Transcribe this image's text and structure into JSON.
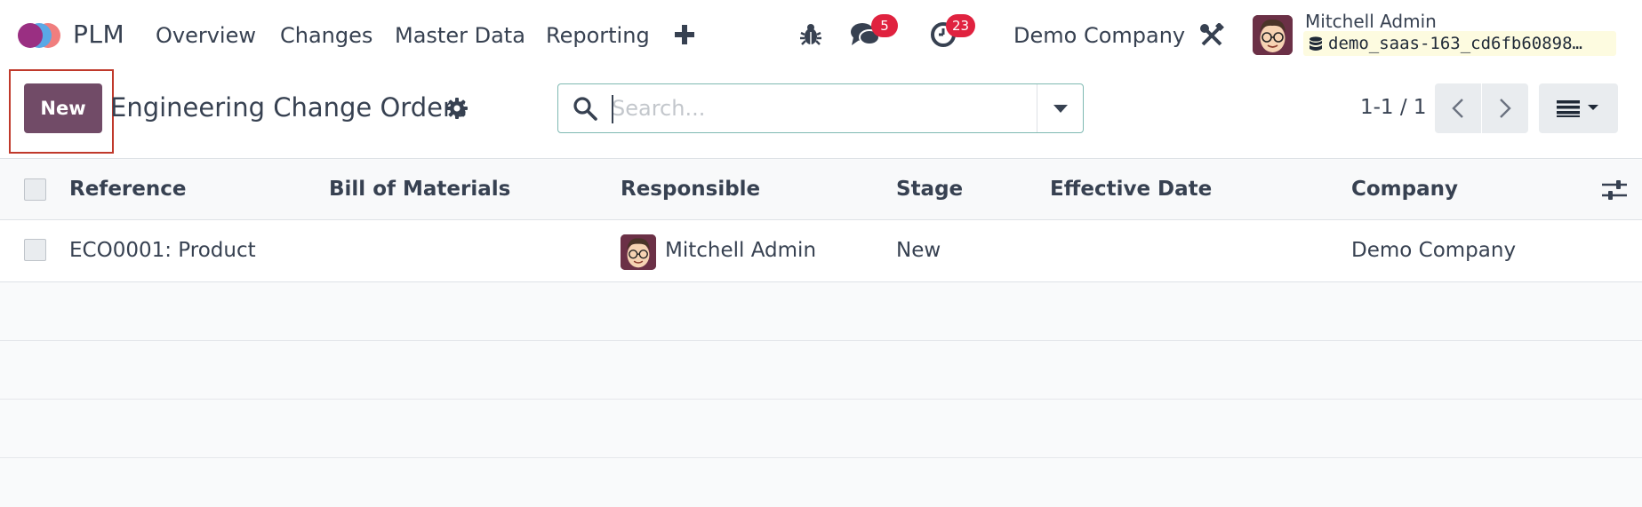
{
  "app": {
    "name": "PLM"
  },
  "menu": [
    "Overview",
    "Changes",
    "Master Data",
    "Reporting"
  ],
  "systray": {
    "messages_count": "5",
    "activities_count": "23",
    "company": "Demo Company",
    "user_name": "Mitchell Admin",
    "database": "demo_saas-163_cd6fb60898…"
  },
  "control": {
    "new_label": "New",
    "title": "Engineering Change Orders",
    "search_placeholder": "Search...",
    "pager": "1-1 / 1"
  },
  "table": {
    "columns": [
      "Reference",
      "Bill of Materials",
      "Responsible",
      "Stage",
      "Effective Date",
      "Company"
    ],
    "rows": [
      {
        "reference": "ECO0001: Product",
        "bom": "",
        "responsible": "Mitchell Admin",
        "stage": "New",
        "effective_date": "",
        "company": "Demo Company"
      }
    ]
  },
  "colors": {
    "primary": "#714b67",
    "badge": "#e0223f",
    "highlight": "#c0392b",
    "search_border": "#7fb9b2"
  },
  "icons": [
    "odoo-logo-icon",
    "plus-icon",
    "bug-icon",
    "chat-icon",
    "clock-icon",
    "tools-icon",
    "database-icon",
    "gear-icon",
    "search-icon",
    "caret-down-icon",
    "chevron-left-icon",
    "chevron-right-icon",
    "list-view-icon",
    "sliders-icon"
  ]
}
